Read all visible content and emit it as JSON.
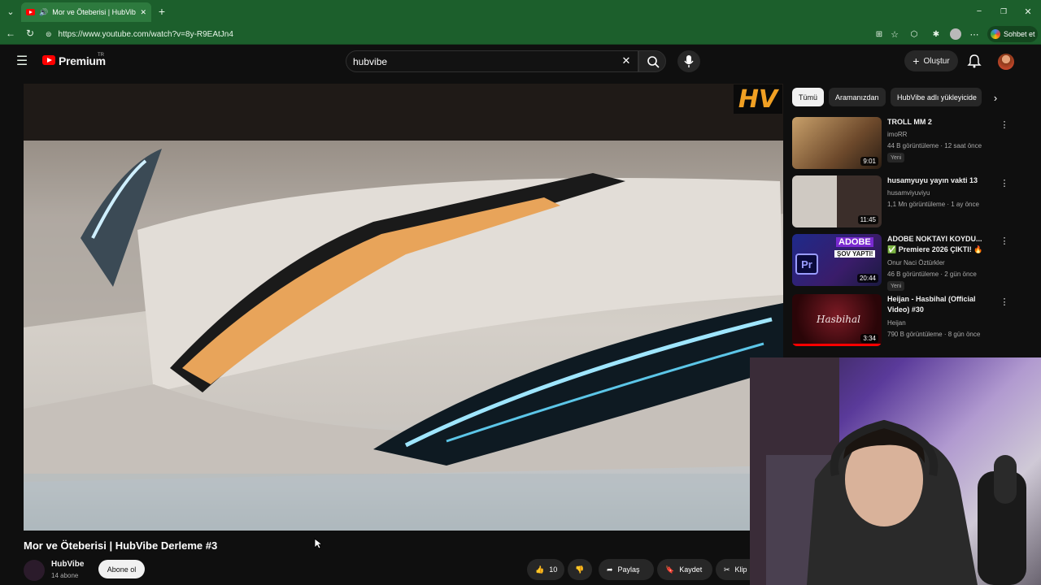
{
  "browser": {
    "tab_title": "Mor ve Öteberisi | HubVibe De",
    "new_tab": "+",
    "url": "https://www.youtube.com/watch?v=8y-R9EAtJn4",
    "chat_button": "Sohbet et",
    "window_controls": [
      "−",
      "❐",
      "✕"
    ]
  },
  "header": {
    "logo_text": "Premium",
    "region": "TR",
    "search_value": "hubvibe",
    "create_label": "Oluştur"
  },
  "video": {
    "watermark": "HV",
    "title": "Mor ve Öteberisi | HubVibe Derleme #3",
    "channel": "HubVibe",
    "subscribers": "14 abone",
    "subscribe_label": "Abone ol",
    "likes": "10",
    "share_label": "Paylaş",
    "save_label": "Kaydet",
    "clip_label": "Klip"
  },
  "chips": [
    "Tümü",
    "Aramanızdan",
    "HubVibe adlı yükleyicide"
  ],
  "recommendations": [
    {
      "title": "TROLL MM 2",
      "channel": "imoRR",
      "meta": "44 B görüntüleme · 12 saat önce",
      "badge": "Yeni",
      "duration": "9:01",
      "thumb_color": "#7a5a3a"
    },
    {
      "title": "husamyuyu yayın vakti 13",
      "channel": "husamviyuviyu",
      "meta": "1,1 Mn görüntüleme · 1 ay önce",
      "badge": "",
      "duration": "11:45",
      "thumb_color": "#4a3a3a"
    },
    {
      "title": "ADOBE NOKTAYI KOYDU... ✅ Premiere 2026 ÇIKTI! 🔥",
      "channel": "Onur Naci Öztürkler",
      "meta": "46 B görüntüleme · 2 gün önce",
      "badge": "Yeni",
      "duration": "20:44",
      "thumb_color": "#2a2a7a"
    },
    {
      "title": "Heijan - Hasbihal (Official Video) #30",
      "channel": "Heijan",
      "meta": "790 B görüntüleme · 8 gün önce",
      "badge": "",
      "duration": "3:34",
      "thumb_color": "#3a0a10"
    }
  ],
  "thumb_texts": {
    "adobe": "ADOBE",
    "sov": "ŞOV YAPTI!",
    "pr": "Pr",
    "hasbihal": "Hasbihal"
  }
}
